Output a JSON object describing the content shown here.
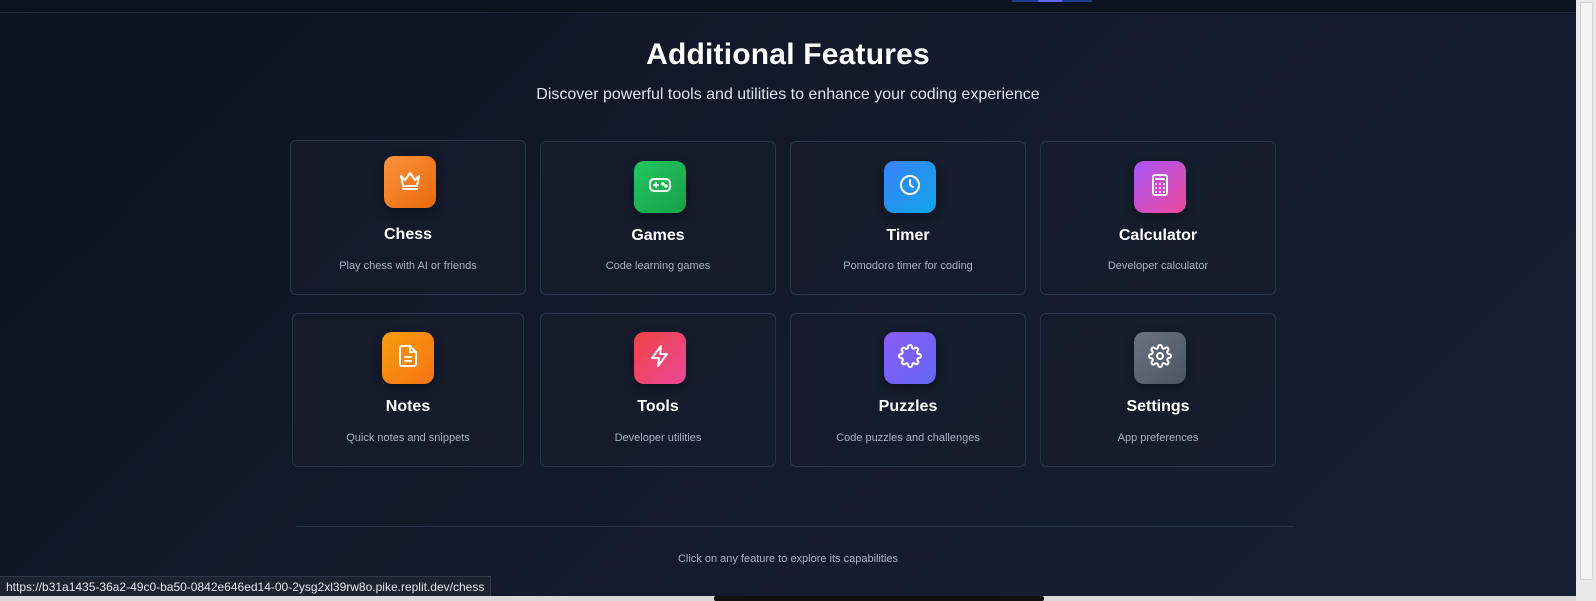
{
  "header": {
    "title": "Additional Features",
    "subtitle": "Discover powerful tools and utilities to enhance your coding experience"
  },
  "features": [
    {
      "title": "Chess",
      "description": "Play chess with AI or friends",
      "icon": "crown-icon",
      "gradient": [
        "#fb923c",
        "#ea6a0c"
      ]
    },
    {
      "title": "Games",
      "description": "Code learning games",
      "icon": "gamepad-icon",
      "gradient": [
        "#22c55e",
        "#16a34a"
      ]
    },
    {
      "title": "Timer",
      "description": "Pomodoro timer for coding",
      "icon": "clock-icon",
      "gradient": [
        "#3b82f6",
        "#0ea5e9"
      ]
    },
    {
      "title": "Calculator",
      "description": "Developer calculator",
      "icon": "calculator-icon",
      "gradient": [
        "#a855f7",
        "#ec4899"
      ]
    },
    {
      "title": "Notes",
      "description": "Quick notes and snippets",
      "icon": "file-text-icon",
      "gradient": [
        "#f59e0b",
        "#f97316"
      ]
    },
    {
      "title": "Tools",
      "description": "Developer utilities",
      "icon": "zap-icon",
      "gradient": [
        "#ef4444",
        "#ec4899"
      ]
    },
    {
      "title": "Puzzles",
      "description": "Code puzzles and challenges",
      "icon": "puzzle-icon",
      "gradient": [
        "#8b5cf6",
        "#6366f1"
      ]
    },
    {
      "title": "Settings",
      "description": "App preferences",
      "icon": "gear-icon",
      "gradient": [
        "#6b7280",
        "#4b5563"
      ]
    }
  ],
  "footer": {
    "hint": "Click on any feature to explore its capabilities"
  },
  "status_bar": {
    "url": "https://b31a1435-36a2-49c0-ba50-0842e646ed14-00-2ysg2xl39rw8o.pike.replit.dev/chess"
  }
}
